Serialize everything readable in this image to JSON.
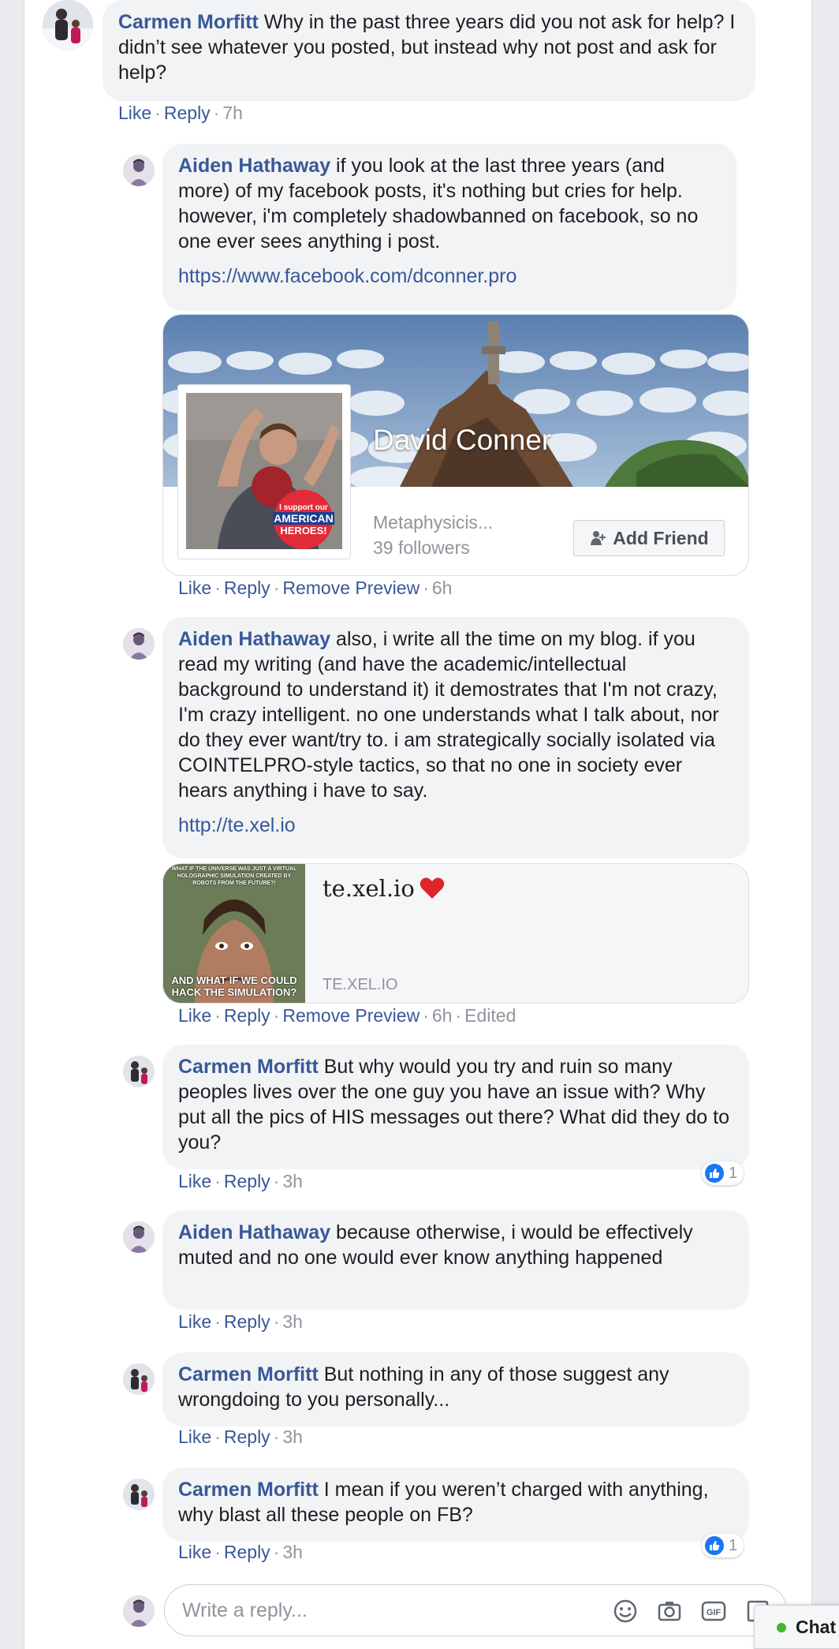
{
  "comments": [
    {
      "author": "Carmen Morfitt",
      "text": " Why in the past three years did you not ask for help? I didn’t see whatever you posted, but instead why not post and ask for help?",
      "like": "Like",
      "reply": "Reply",
      "time": "7h"
    },
    {
      "author": "Aiden Hathaway",
      "text": " if you look at the last three years (and more) of my facebook posts, it's nothing but cries for help. however, i'm completely shadowbanned on facebook, so no one ever sees anything i post.",
      "link": "https://www.facebook.com/dconner.pro",
      "preview": {
        "name": "David Conner",
        "category": "Metaphysicis...",
        "followers": "39 followers",
        "add_friend": "Add Friend",
        "badge_line1": "I support our",
        "badge_line2": "AMERICAN",
        "badge_line3": "HEROES!"
      },
      "like": "Like",
      "reply": "Reply",
      "remove_preview": "Remove Preview",
      "time": "6h"
    },
    {
      "author": "Aiden Hathaway",
      "text": " also, i write all the time on my blog. if you read my writing (and have the academic/intellectual background to understand it) it demostrates that I'm not crazy, I'm crazy intelligent. no one understands what I talk about, nor do they ever want/try to. i am strategically socially isolated via COINTELPRO-style tactics, so that no one in society ever hears anything i have to say.",
      "link": "http://te.xel.io",
      "preview": {
        "title": "te.xel.io",
        "domain": "TE.XEL.IO",
        "meme_top": "WHAT IF THE UNIVERSE WAS JUST A VIRTUAL HOLOGRAPHIC SIMULATION CREATED BY ROBOTS FROM THE FUTURE?!",
        "meme_bottom": "AND WHAT IF WE COULD HACK THE SIMULATION?"
      },
      "like": "Like",
      "reply": "Reply",
      "remove_preview": "Remove Preview",
      "time": "6h",
      "edited": "Edited"
    },
    {
      "author": "Carmen Morfitt",
      "text": " But why would you try and ruin so many peoples lives over the one guy you have an issue with? Why put all the pics of HIS messages out there? What did they do to you?",
      "like": "Like",
      "reply": "Reply",
      "time": "3h",
      "reactions": "1"
    },
    {
      "author": "Aiden Hathaway",
      "text": " because otherwise, i would be effectively muted and no one would ever know anything happened",
      "like": "Like",
      "reply": "Reply",
      "time": "3h"
    },
    {
      "author": "Carmen Morfitt",
      "text": " But nothing in any of those suggest any wrongdoing to you personally...",
      "like": "Like",
      "reply": "Reply",
      "time": "3h"
    },
    {
      "author": "Carmen Morfitt",
      "text": " I mean if you weren’t charged with anything, why blast all these people on FB?",
      "like": "Like",
      "reply": "Reply",
      "time": "3h",
      "reactions": "1"
    }
  ],
  "reply_box": {
    "placeholder": "Write a reply..."
  },
  "chat": {
    "label": "Chat"
  },
  "colors": {
    "link": "#385898",
    "bubble": "#f2f3f5",
    "meta": "#90949c",
    "like_blue": "#1877f2",
    "online_green": "#42b72a"
  }
}
